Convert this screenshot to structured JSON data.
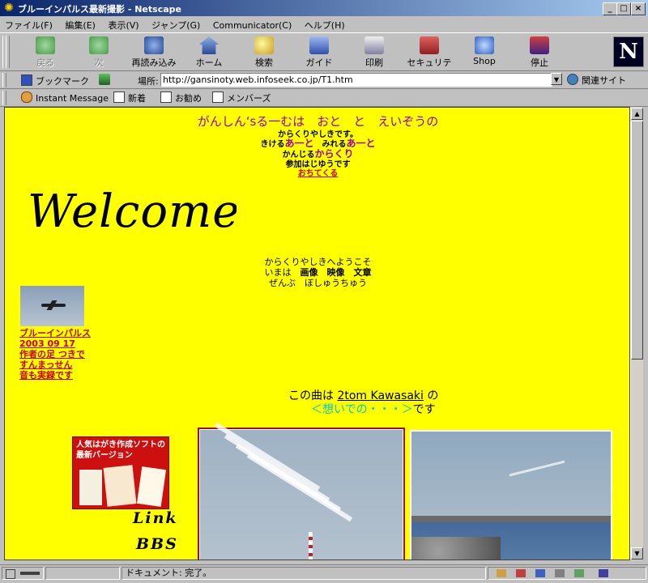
{
  "window": {
    "title": "ブルーインパルス最新撮影 - Netscape",
    "buttons": {
      "minimize": "_",
      "maximize": "□",
      "close": "×"
    }
  },
  "menu": {
    "items": [
      "ファイル(F)",
      "編集(E)",
      "表示(V)",
      "ジャンプ(G)",
      "Communicator(C)",
      "ヘルプ(H)"
    ]
  },
  "toolbar": {
    "buttons": [
      {
        "label": "戻る",
        "icon": "back-arrow-icon"
      },
      {
        "label": "次",
        "icon": "forward-arrow-icon"
      },
      {
        "label": "再読み込み",
        "icon": "reload-icon"
      },
      {
        "label": "ホーム",
        "icon": "home-icon"
      },
      {
        "label": "検索",
        "icon": "search-icon"
      },
      {
        "label": "ガイド",
        "icon": "guide-icon"
      },
      {
        "label": "印刷",
        "icon": "print-icon"
      },
      {
        "label": "セキュリティ",
        "icon": "security-lock-icon"
      },
      {
        "label": "Shop",
        "icon": "shop-icon"
      },
      {
        "label": "停止",
        "icon": "stop-icon"
      }
    ],
    "logo": "N"
  },
  "location": {
    "bookmark_label": "ブックマーク",
    "location_label": "場所:",
    "url": "http://gansinoty.web.infoseek.co.jp/T1.htm",
    "related_label": "関連サイト"
  },
  "personal": {
    "items": [
      "Instant Message",
      "新着",
      "お勧め",
      "メンバーズ"
    ]
  },
  "page": {
    "heading": "がんしん‘sる一むは　おと　と　えいぞうの",
    "line1": "からくりやしきです。",
    "line2a": "きける",
    "line2b": "あ一と",
    "line2c": "　みれる",
    "line2d": "あ一と",
    "line3a": "かんじる",
    "line3b": "からくり",
    "line4": "参加はじゆうです",
    "line5": "おちてくる",
    "welcome": "Welcome!",
    "intro1": "からくりやしきへようこそ",
    "intro2a": "いまは　",
    "intro2b": "画像　映像　文章",
    "intro3": "ぜんぶ　ぼしゅうちゅう",
    "side_link": [
      "ブルーインパルス",
      "2003 09 17",
      "作者の足 つきで",
      "すんまっせん",
      "音も実録です"
    ],
    "song1a": "この曲は ",
    "song1b": "2tom Kawasaki",
    "song1c": " の",
    "song2a": "＜想いでの・・・＞",
    "song2b": "です",
    "ad_text": "人気はがき作成ソフトの最新バージョン",
    "nav_link": "Link",
    "nav_bbs": "BBS"
  },
  "status": {
    "text": "ドキュメント: 完了。"
  },
  "colors": {
    "page_bg": "#ffff00",
    "heading": "#a000a0",
    "link": "#cc0000",
    "song_title": "#00cccc",
    "chrome": "#c0c0c0"
  }
}
